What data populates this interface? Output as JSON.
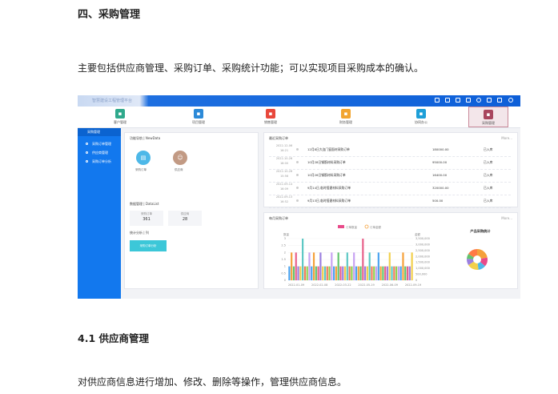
{
  "doc": {
    "section_heading": "四、采购管理",
    "intro": "主要包括供应商管理、采购订单、采购统计功能；可以实现项目采购成本的确认。",
    "sub_heading": "4.1 供应商管理",
    "sub_text": "对供应商信息进行增加、修改、删除等操作，管理供应商信息。"
  },
  "screenshot": {
    "brand": "智慧建设工程管理平台",
    "modules": [
      {
        "label": "客户管理",
        "color": "#2fa98c",
        "icon": "user-icon"
      },
      {
        "label": "项目管理",
        "color": "#2c8ad8",
        "icon": "project-icon"
      },
      {
        "label": "销售管理",
        "color": "#e8483c",
        "icon": "sales-icon"
      },
      {
        "label": "财务管理",
        "color": "#f2a531",
        "icon": "finance-icon"
      },
      {
        "label": "协同办公",
        "color": "#1e9fd8",
        "icon": "office-icon"
      },
      {
        "label": "采购管理",
        "color": "#a8465e",
        "icon": "cart-icon"
      }
    ],
    "sidebar": {
      "header": "采购管理",
      "items": [
        "采购订单管理",
        "供应商管理",
        "采购订单分析"
      ]
    },
    "new_data": {
      "title": "功能导航 | NewData",
      "items": [
        {
          "label": "采购订单",
          "color": "#4db8e8"
        },
        {
          "label": "供应商",
          "color": "#c29a84"
        }
      ]
    },
    "data_list": {
      "title": "数据管理 | DataList",
      "stats": [
        {
          "label": "采购订单",
          "value": "361"
        },
        {
          "label": "供应商",
          "value": "28"
        }
      ]
    },
    "stats_title": "统计分析 | 列",
    "stats_button": "采购订单分析",
    "recent": {
      "title": "最近采购订单",
      "more": "More...",
      "rows": [
        {
          "date": "2022-12-06",
          "time": "16:21",
          "name": "12月8日大连门窗面材采购订单",
          "amount": "180000.00",
          "status": "已入库"
        },
        {
          "date": "2022-10-26",
          "time": "18:00",
          "name": "10月28日钢筋材料采购订单",
          "amount": "95000.00",
          "status": "已入库"
        },
        {
          "date": "2022-10-26",
          "time": "15:56",
          "name": "10月26日钢筋材料采购订单",
          "amount": "16400.00",
          "status": "已入库"
        },
        {
          "date": "2022-09-14",
          "time": "16:09",
          "name": "9月14日,临时搭建材料采购订单",
          "amount": "320000.00",
          "status": "已入库"
        },
        {
          "date": "2022-09-13",
          "time": "16:52",
          "name": "9月13日,临时搭建材料采购订单",
          "amount": "500.00",
          "status": "已入库"
        }
      ]
    },
    "chart_panel": {
      "title": "每月采购订单",
      "more": "More...",
      "pie_title": "产品采购统计"
    }
  },
  "chart_data": {
    "type": "bar",
    "legend": [
      "订单数量",
      "订单金额"
    ],
    "yleft_label": "数量",
    "yright_label": "金额",
    "yleft_ticks": [
      "3",
      "2.5",
      "2",
      "1.5",
      "1",
      "0.5",
      "0"
    ],
    "yright_ticks": [
      "3,500,000",
      "3,000,000",
      "2,500,000",
      "2,000,000",
      "1,500,000",
      "1,000,000",
      "500,000",
      "0"
    ],
    "x_ticks": [
      "2022-01-09",
      "2022-02-08",
      "2022-03-22",
      "2022-05-19",
      "2022-06-09",
      "2022-09-19"
    ],
    "bars": [
      1,
      2,
      1,
      2,
      1,
      1,
      3,
      1,
      1,
      2,
      1,
      2,
      1,
      1,
      2,
      1,
      1,
      1,
      1,
      2,
      1,
      1,
      2,
      1,
      1,
      1,
      2,
      1,
      1,
      2,
      1,
      1,
      1,
      3,
      1,
      1,
      2,
      1,
      1,
      1,
      2,
      1,
      1,
      1,
      1,
      2,
      1,
      1,
      1,
      1,
      1,
      2,
      1,
      1,
      1,
      2
    ],
    "bar_colors": [
      "#4aa3f0",
      "#f5a13a",
      "#62c46e",
      "#e8608a",
      "#9b7fe0",
      "#f2d04c",
      "#5cc8c4",
      "#f07a5a",
      "#8fd14f",
      "#c7a2f2"
    ],
    "pie": {
      "values": [
        22,
        14,
        12,
        18,
        10,
        8,
        16
      ],
      "colors": [
        "#f5a13a",
        "#e84b8a",
        "#4db8e8",
        "#f2d04c",
        "#9b7fe0",
        "#62c46e",
        "#ff7a45"
      ]
    }
  }
}
